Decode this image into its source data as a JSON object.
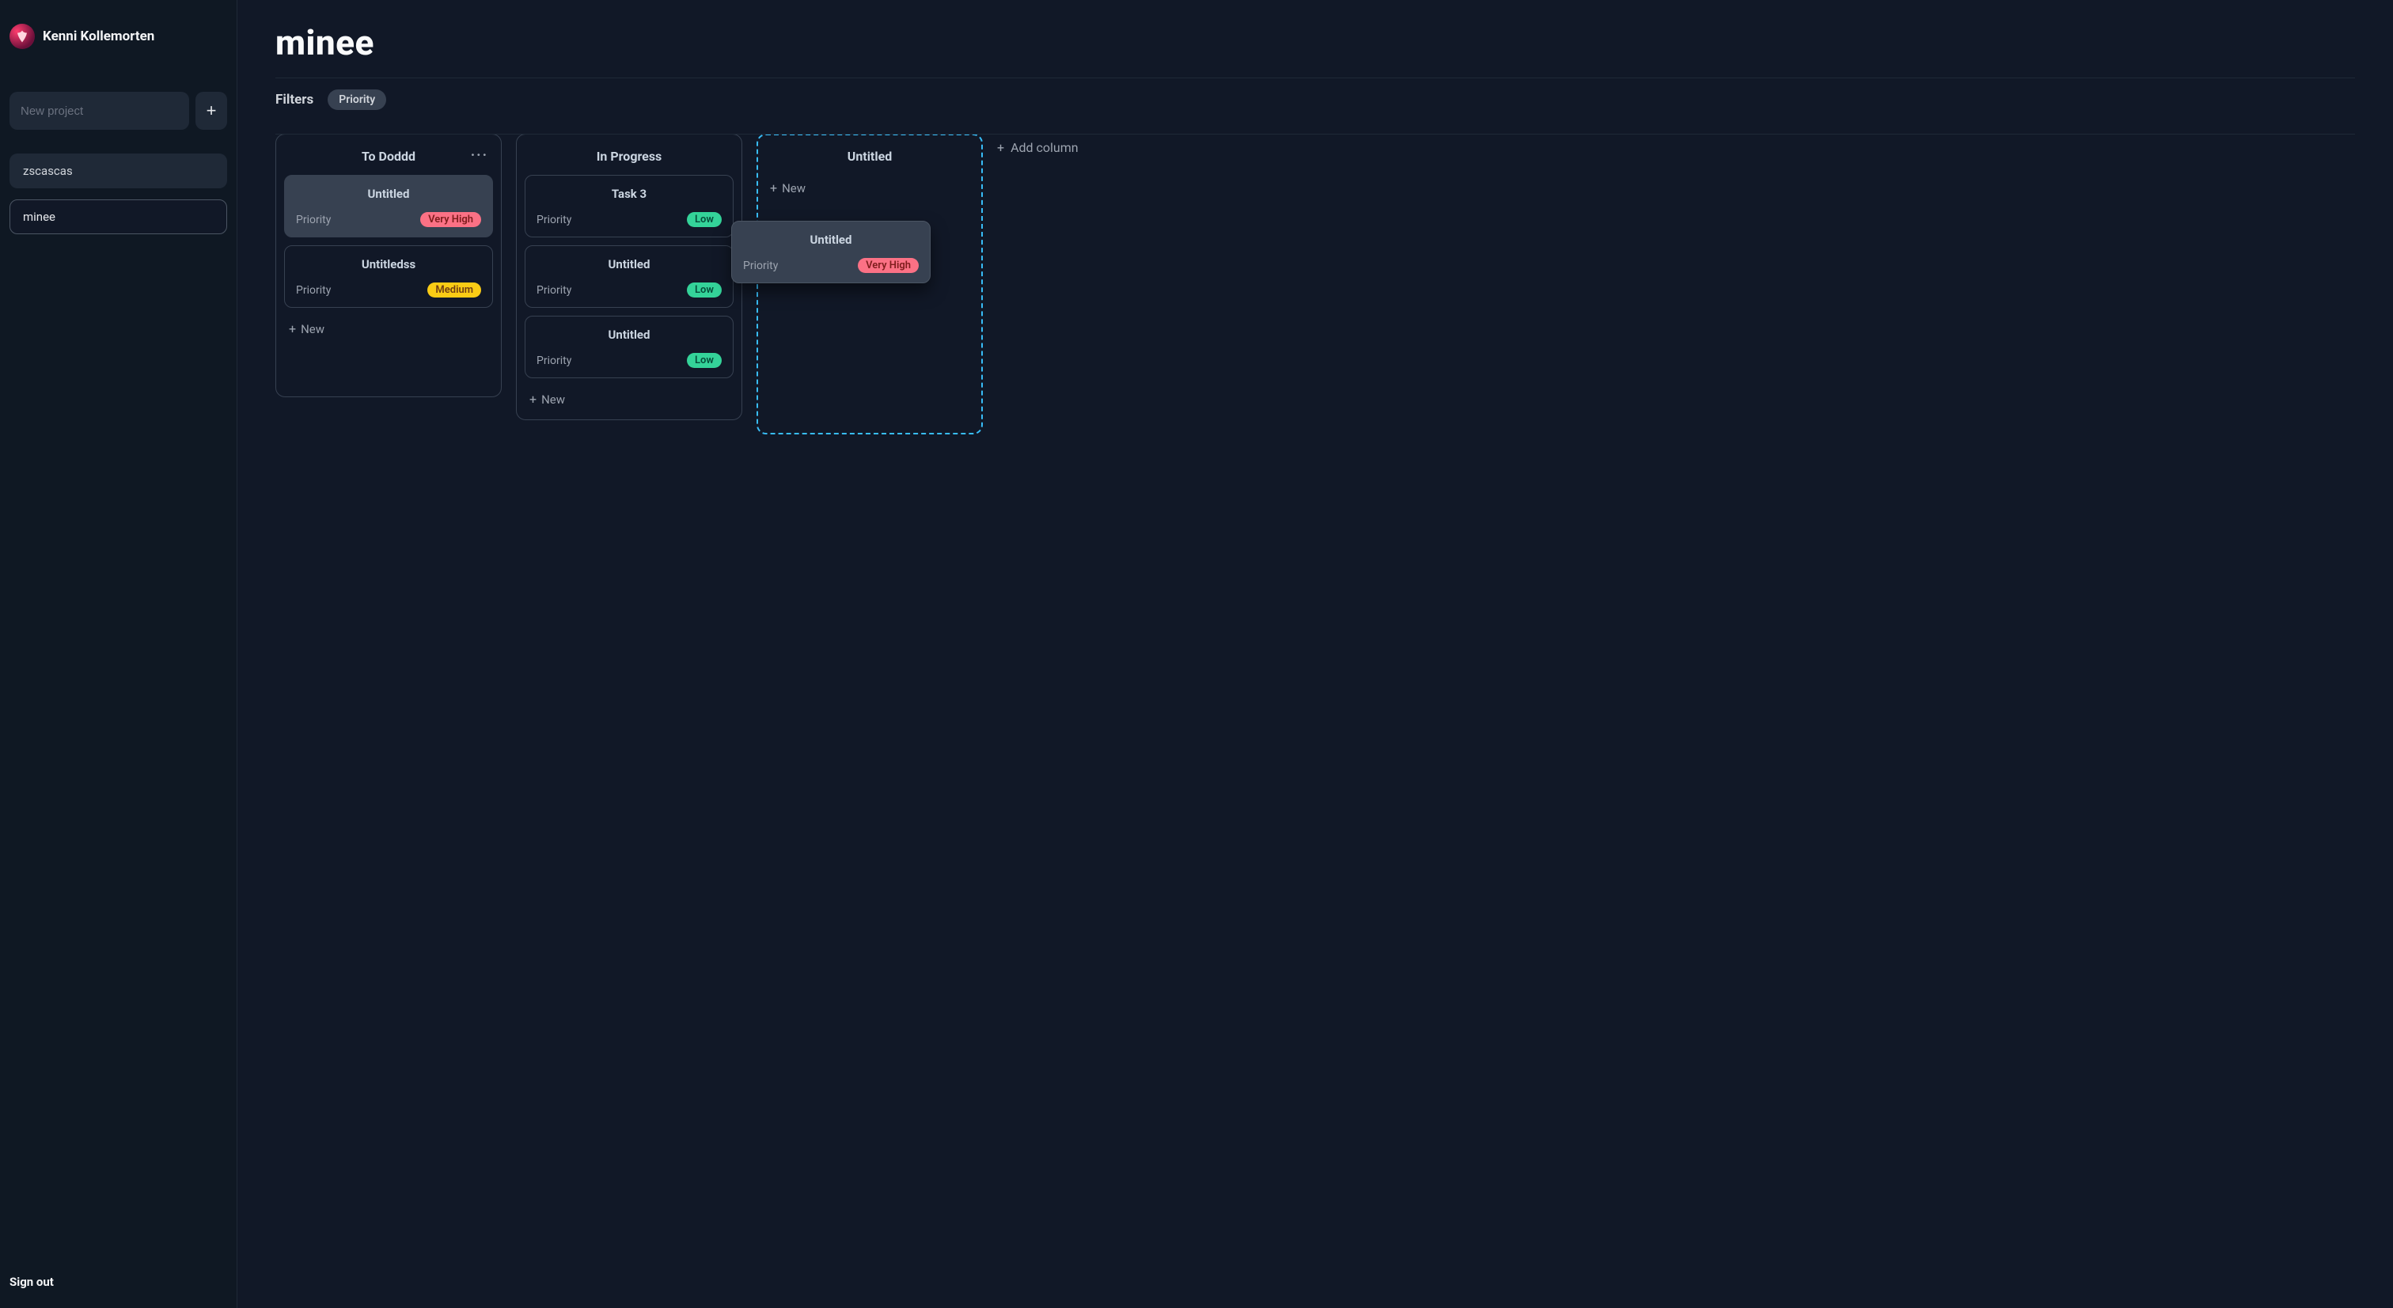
{
  "user": {
    "name": "Kenni Kollemorten"
  },
  "sidebar": {
    "new_project_placeholder": "New project",
    "projects": [
      {
        "label": "zscascas"
      },
      {
        "label": "minee"
      }
    ],
    "sign_out": "Sign out"
  },
  "board": {
    "title": "minee",
    "filters_label": "Filters",
    "filter_pill": "Priority",
    "add_column_label": "Add column",
    "new_label": "New",
    "priority_label": "Priority",
    "columns": [
      {
        "title": "To Doddd",
        "cards": [
          {
            "title": "Untitled",
            "priority": "Very High",
            "priority_class": "very-high",
            "selected": true
          },
          {
            "title": "Untitledss",
            "priority": "Medium",
            "priority_class": "medium"
          }
        ]
      },
      {
        "title": "In Progress",
        "cards": [
          {
            "title": "Task 3",
            "priority": "Low",
            "priority_class": "low"
          },
          {
            "title": "Untitled",
            "priority": "Low",
            "priority_class": "low"
          },
          {
            "title": "Untitled",
            "priority": "Low",
            "priority_class": "low"
          }
        ]
      },
      {
        "title": "Untitled",
        "drop_target": true,
        "cards": []
      }
    ],
    "drag_ghost": {
      "title": "Untitled",
      "priority": "Very High",
      "priority_class": "very-high"
    }
  }
}
